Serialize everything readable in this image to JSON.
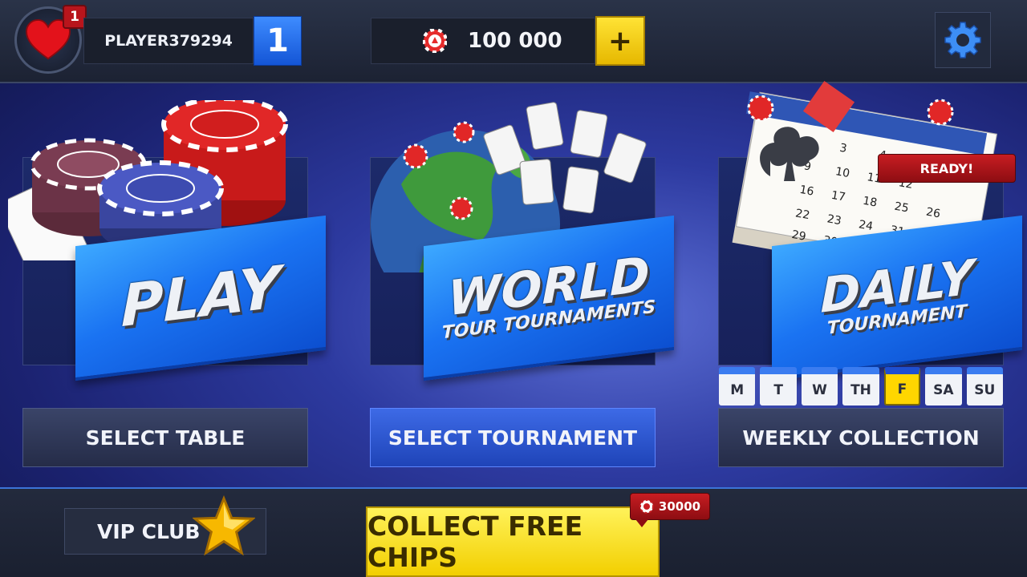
{
  "header": {
    "heart_badge": "1",
    "player_name": "PLAYER379294",
    "level": "1",
    "chips": "100 000",
    "add_chips_label": "+"
  },
  "panels": [
    {
      "title": "PLAY",
      "subtitle": "",
      "button": "SELECT TABLE"
    },
    {
      "title": "WORLD",
      "subtitle": "TOUR TOURNAMENTS",
      "button": "SELECT TOURNAMENT"
    },
    {
      "title": "DAILY",
      "subtitle": "TOURNAMENT",
      "button": "WEEKLY COLLECTION",
      "badge": "READY!"
    }
  ],
  "days": [
    "M",
    "T",
    "W",
    "TH",
    "F",
    "SA",
    "SU"
  ],
  "active_day": "F",
  "footer": {
    "vip_label": "VIP CLUB",
    "collect_label": "COLLECT FREE CHIPS",
    "bonus_amount": "30000"
  },
  "colors": {
    "accent_blue": "#1a73f2",
    "gold": "#f2cf00",
    "red": "#c81d22"
  }
}
